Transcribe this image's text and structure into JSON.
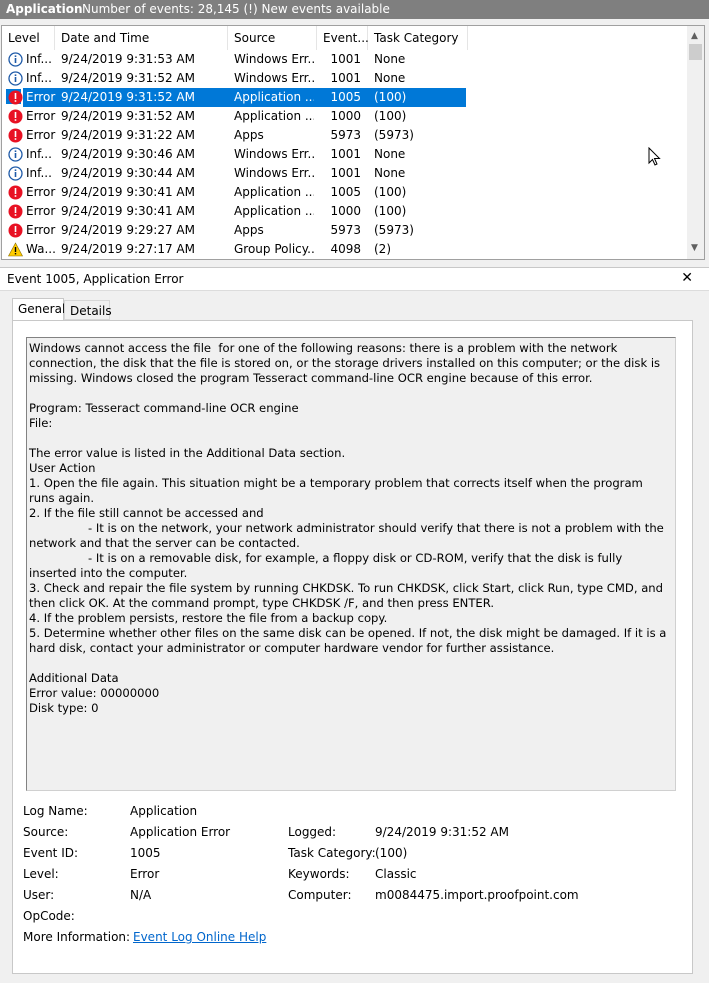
{
  "header": {
    "title": "Application",
    "info": "Number of events: 28,145 (!) New events available"
  },
  "columns": {
    "level": "Level",
    "date": "Date and Time",
    "source": "Source",
    "event_id": "Event...",
    "category": "Task Category"
  },
  "rows": [
    {
      "type": "info",
      "level": "Inf...",
      "date": "9/24/2019 9:31:53 AM",
      "source": "Windows Err...",
      "event_id": "1001",
      "category": "None"
    },
    {
      "type": "info",
      "level": "Inf...",
      "date": "9/24/2019 9:31:52 AM",
      "source": "Windows Err...",
      "event_id": "1001",
      "category": "None"
    },
    {
      "type": "error",
      "level": "Error",
      "date": "9/24/2019 9:31:52 AM",
      "source": "Application ...",
      "event_id": "1005",
      "category": "(100)",
      "selected": true
    },
    {
      "type": "error",
      "level": "Error",
      "date": "9/24/2019 9:31:52 AM",
      "source": "Application ...",
      "event_id": "1000",
      "category": "(100)"
    },
    {
      "type": "error",
      "level": "Error",
      "date": "9/24/2019 9:31:22 AM",
      "source": "Apps",
      "event_id": "5973",
      "category": "(5973)"
    },
    {
      "type": "info",
      "level": "Inf...",
      "date": "9/24/2019 9:30:46 AM",
      "source": "Windows Err...",
      "event_id": "1001",
      "category": "None"
    },
    {
      "type": "info",
      "level": "Inf...",
      "date": "9/24/2019 9:30:44 AM",
      "source": "Windows Err...",
      "event_id": "1001",
      "category": "None"
    },
    {
      "type": "error",
      "level": "Error",
      "date": "9/24/2019 9:30:41 AM",
      "source": "Application ...",
      "event_id": "1005",
      "category": "(100)"
    },
    {
      "type": "error",
      "level": "Error",
      "date": "9/24/2019 9:30:41 AM",
      "source": "Application ...",
      "event_id": "1000",
      "category": "(100)"
    },
    {
      "type": "error",
      "level": "Error",
      "date": "9/24/2019 9:29:27 AM",
      "source": "Apps",
      "event_id": "5973",
      "category": "(5973)"
    },
    {
      "type": "warning",
      "level": "Wa...",
      "date": "9/24/2019 9:27:17 AM",
      "source": "Group Policy...",
      "event_id": "4098",
      "category": "(2)"
    }
  ],
  "detail": {
    "title": "Event 1005, Application Error",
    "tabs": {
      "general": "General",
      "details": "Details"
    },
    "description": "Windows cannot access the file  for one of the following reasons: there is a problem with the network connection, the disk that the file is stored on, or the storage drivers installed on this computer; or the disk is missing. Windows closed the program Tesseract command-line OCR engine because of this error.\n\nProgram: Tesseract command-line OCR engine\nFile: \n\nThe error value is listed in the Additional Data section.\nUser Action\n1. Open the file again. This situation might be a temporary problem that corrects itself when the program runs again.\n2. If the file still cannot be accessed and\n                - It is on the network, your network administrator should verify that there is not a problem with the network and that the server can be contacted.\n                - It is on a removable disk, for example, a floppy disk or CD-ROM, verify that the disk is fully inserted into the computer.\n3. Check and repair the file system by running CHKDSK. To run CHKDSK, click Start, click Run, type CMD, and then click OK. At the command prompt, type CHKDSK /F, and then press ENTER.\n4. If the problem persists, restore the file from a backup copy.\n5. Determine whether other files on the same disk can be opened. If not, the disk might be damaged. If it is a hard disk, contact your administrator or computer hardware vendor for further assistance.\n\nAdditional Data\nError value: 00000000\nDisk type: 0"
  },
  "props": {
    "log_name_label": "Log Name:",
    "log_name": "Application",
    "source_label": "Source:",
    "source": "Application Error",
    "logged_label": "Logged:",
    "logged": "9/24/2019 9:31:52 AM",
    "event_id_label": "Event ID:",
    "event_id": "1005",
    "task_category_label": "Task Category:",
    "task_category": "(100)",
    "level_label": "Level:",
    "level": "Error",
    "keywords_label": "Keywords:",
    "keywords": "Classic",
    "user_label": "User:",
    "user": "N/A",
    "computer_label": "Computer:",
    "computer": "m0084475.import.proofpoint.com",
    "opcode_label": "OpCode:",
    "more_info_label": "More Information:",
    "more_info_link": "Event Log Online Help"
  },
  "colors": {
    "selection": "#0078d7",
    "error": "#e81123",
    "info": "#1e5aa8",
    "warning": "#ffcc00",
    "link": "#0066cc"
  }
}
